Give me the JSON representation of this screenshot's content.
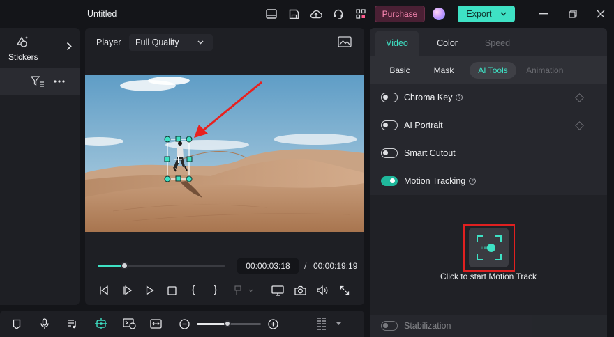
{
  "titlebar": {
    "project_title": "Untitled",
    "purchase_label": "Purchase",
    "export_label": "Export",
    "icons": [
      "layout-icon",
      "save-icon",
      "cloud-upload-icon",
      "headset-icon",
      "apps-grid-icon"
    ]
  },
  "left_panel": {
    "stickers_label": "Stickers"
  },
  "player": {
    "label": "Player",
    "quality": "Full Quality",
    "current_time": "00:00:03:18",
    "separator": "/",
    "total_time": "00:00:19:19",
    "progress": 0.21
  },
  "right_panel": {
    "tabs": [
      "Video",
      "Color",
      "Speed"
    ],
    "active_tab": "Video",
    "subtabs": [
      "Basic",
      "Mask",
      "AI Tools",
      "Animation"
    ],
    "active_subtab": "AI Tools",
    "options": [
      {
        "label": "Chroma Key",
        "on": false,
        "help": true
      },
      {
        "label": "AI Portrait",
        "on": false,
        "help": false
      },
      {
        "label": "Smart Cutout",
        "on": false,
        "help": false
      },
      {
        "label": "Motion Tracking",
        "on": true,
        "help": true
      }
    ],
    "motion_track_prompt": "Click to start Motion Track",
    "stabilization_label": "Stabilization"
  },
  "colors": {
    "accent": "#3ee1c4",
    "highlight": "#e02020",
    "arrow": "#e8211f"
  }
}
